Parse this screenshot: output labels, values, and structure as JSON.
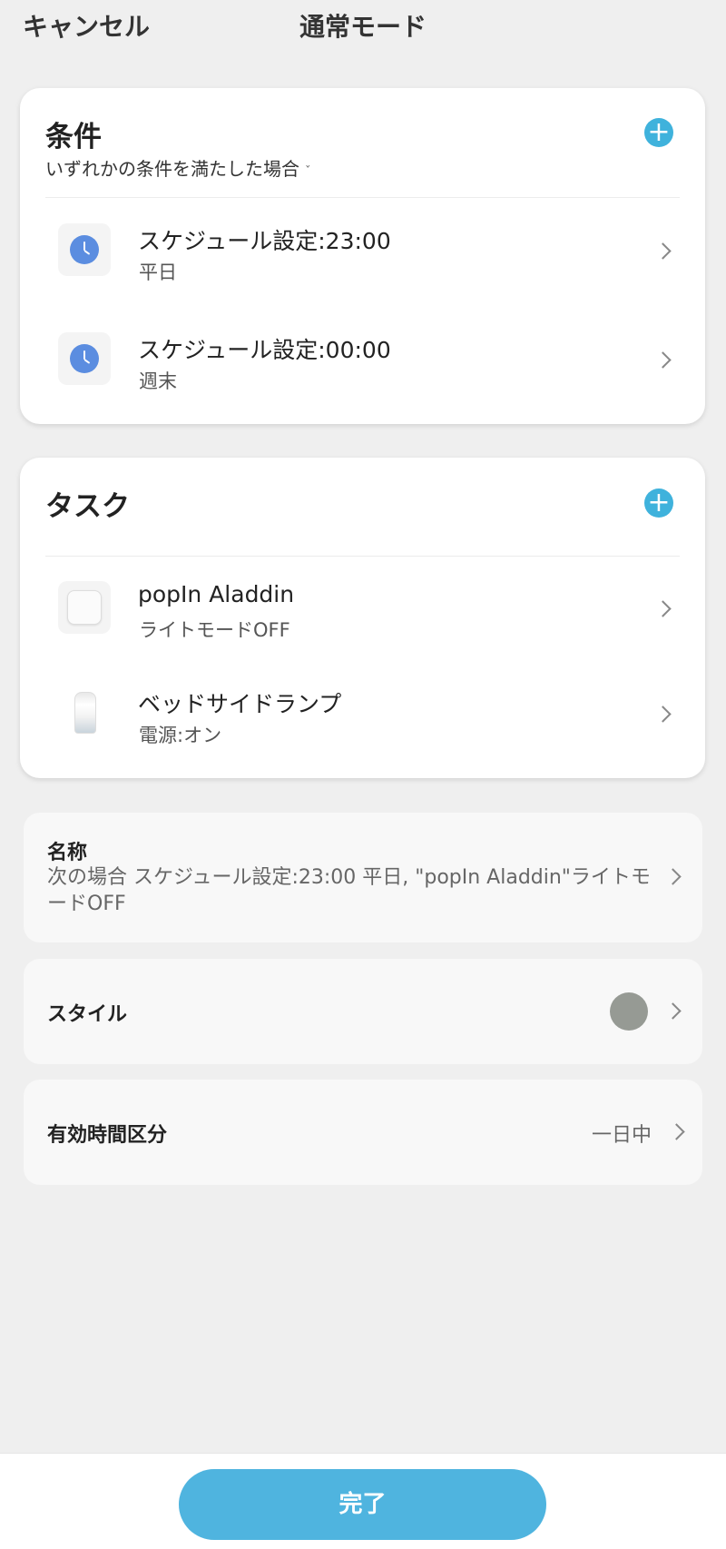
{
  "header": {
    "cancel_label": "キャンセル",
    "title": "通常モード"
  },
  "conditions": {
    "title": "条件",
    "add_icon": "plus-circle-icon",
    "match_mode": "いずれかの条件を満たした場合",
    "match_mode_chevron": "ˇ",
    "items": [
      {
        "icon": "clock-icon",
        "label": "スケジュール設定:23:00",
        "detail": "平日"
      },
      {
        "icon": "clock-icon",
        "label": "スケジュール設定:00:00",
        "detail": "週末"
      }
    ]
  },
  "tasks": {
    "title": "タスク",
    "add_icon": "plus-circle-icon",
    "items": [
      {
        "icon": "projector-device-icon",
        "label": "popIn Aladdin",
        "detail": "ライトモードOFF"
      },
      {
        "icon": "lamp-device-icon",
        "label": "ベッドサイドランプ",
        "detail": "電源:オン"
      }
    ]
  },
  "name_panel": {
    "label": "名称",
    "value": "次の場合 スケジュール設定:23:00 平日, \"popIn Aladdin\"ライトモードOFF"
  },
  "style_panel": {
    "label": "スタイル",
    "color": "#969a94"
  },
  "valid_panel": {
    "label": "有効時間区分",
    "value": "一日中"
  },
  "footer": {
    "done_label": "完了"
  },
  "colors": {
    "accent": "#4fb4df",
    "clock": "#5b8de0"
  }
}
